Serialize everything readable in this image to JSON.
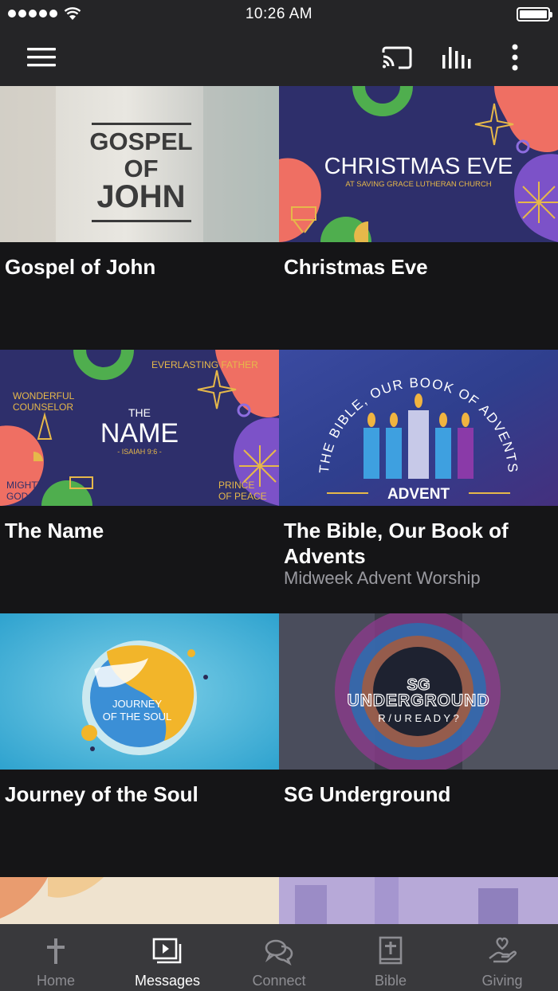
{
  "status": {
    "time": "10:26 AM"
  },
  "toolbar": {
    "menu_icon": "hamburger-menu-icon",
    "cast_icon": "cast-icon",
    "equalizer_icon": "audio-bars-icon",
    "more_icon": "more-vertical-icon"
  },
  "series": [
    {
      "title": "Gospel of John",
      "subtitle": "",
      "art": {
        "line1": "GOSPEL",
        "line2": "OF",
        "line3": "JOHN"
      }
    },
    {
      "title": "Christmas Eve",
      "subtitle": "",
      "art": {
        "heading": "CHRISTMAS EVE",
        "sub": "AT SAVING GRACE LUTHERAN CHURCH"
      }
    },
    {
      "title": "The Name",
      "subtitle": "",
      "art": {
        "the": "THE",
        "name": "NAME",
        "ref": "- ISAIAH 9:6 -",
        "wonderful": "WONDERFUL",
        "counselor": "COUNSELOR",
        "everlasting": "EVERLASTING FATHER",
        "mighty": "MIGHTY",
        "god": "GOD",
        "prince": "PRINCE",
        "peace": "OF PEACE"
      }
    },
    {
      "title": "The Bible, Our Book of Advents",
      "subtitle": "Midweek Advent Worship",
      "art": {
        "arc": "THE BIBLE, OUR BOOK OF ADVENTS",
        "label": "ADVENT"
      }
    },
    {
      "title": "Journey of the Soul",
      "subtitle": "",
      "art": {
        "line1": "JOURNEY",
        "line2": "OF THE SOUL"
      }
    },
    {
      "title": "SG Underground",
      "subtitle": "",
      "art": {
        "sg": "SG",
        "under": "UNDERGROUND",
        "ready": "R / U  R E A D Y ?"
      }
    }
  ],
  "tabs": [
    {
      "label": "Home",
      "icon": "cross-icon",
      "active": false
    },
    {
      "label": "Messages",
      "icon": "video-messages-icon",
      "active": true
    },
    {
      "label": "Connect",
      "icon": "chat-bubbles-icon",
      "active": false
    },
    {
      "label": "Bible",
      "icon": "bible-book-icon",
      "active": false
    },
    {
      "label": "Giving",
      "icon": "giving-hand-heart-icon",
      "active": false
    }
  ]
}
